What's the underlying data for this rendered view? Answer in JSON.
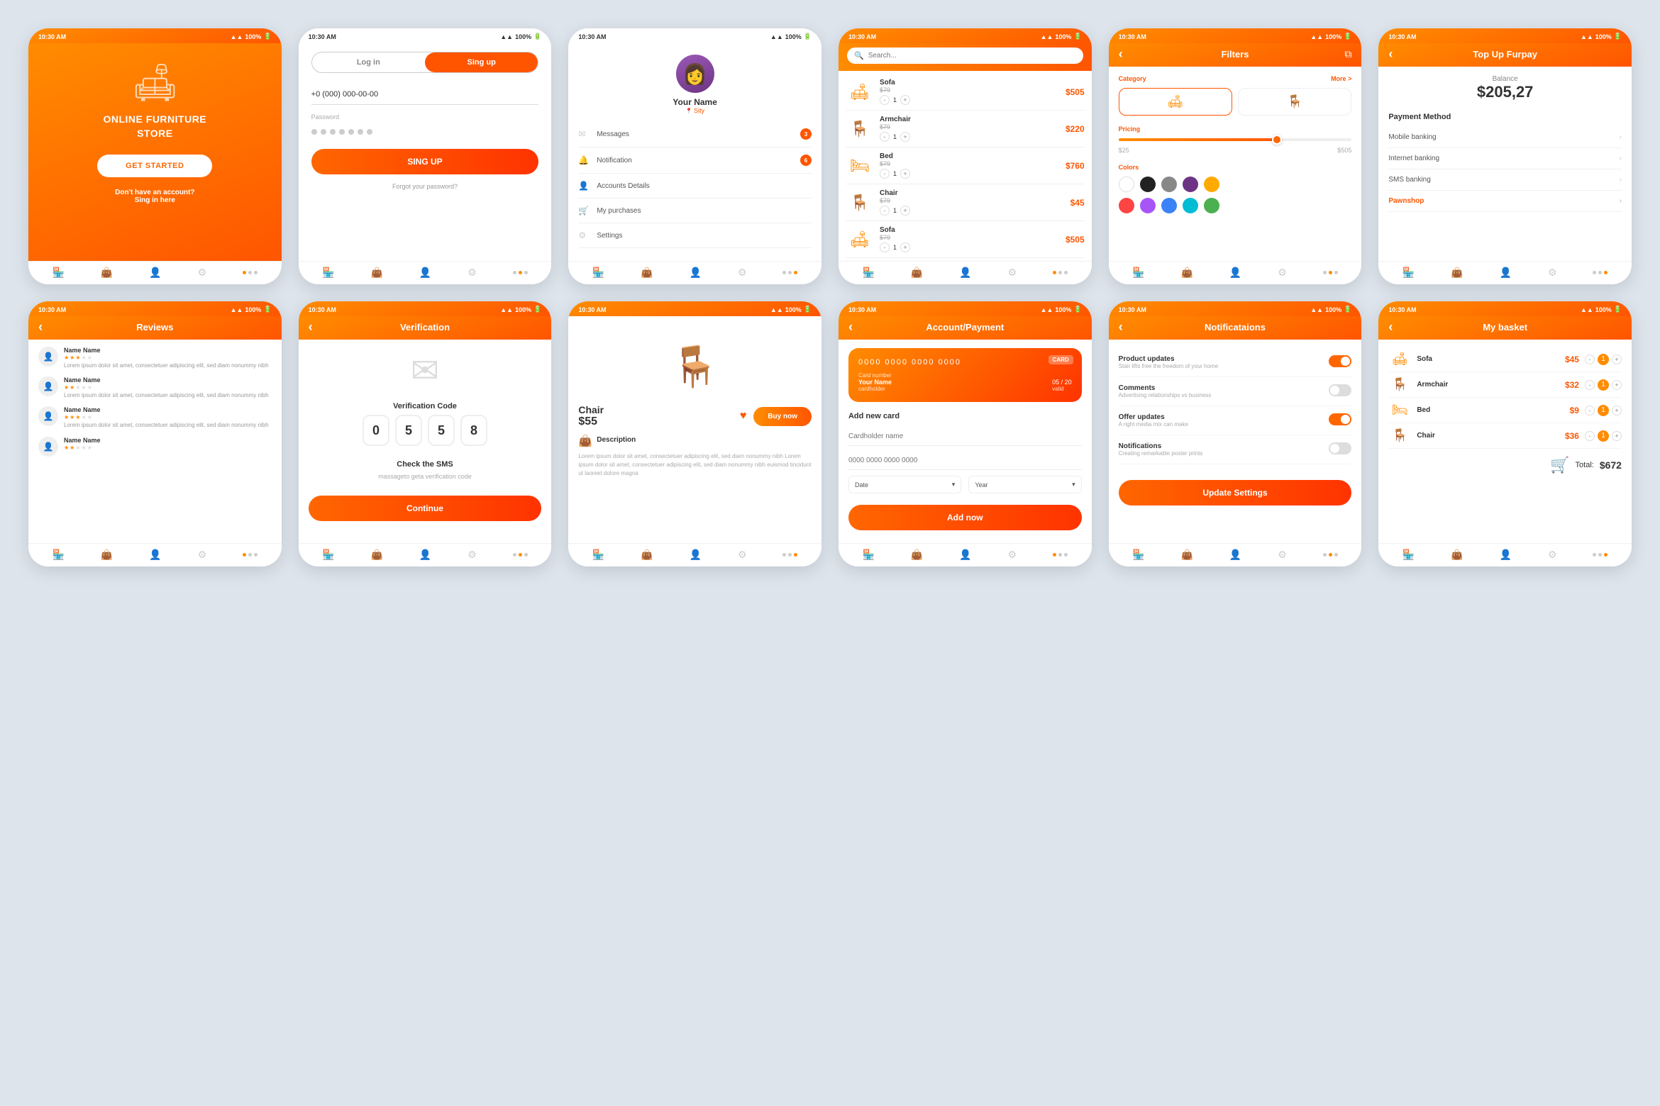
{
  "phone1": {
    "status_time": "10:30 AM",
    "status_battery": "100%",
    "title_line1": "ONLINE FURNITURE",
    "title_line2": "STORE",
    "cta_button": "GET STARTED",
    "signup_prompt": "Don't have an account?",
    "signup_link": "Sing in here"
  },
  "phone2": {
    "status_time": "10:30 AM",
    "status_battery": "100%",
    "tab_login": "Log in",
    "tab_signup": "Sing up",
    "phone_placeholder": "+0 (000) 000-00-00",
    "password_label": "Password",
    "signup_button": "SING UP",
    "forgot_link": "Forgot your password?"
  },
  "phone3": {
    "status_time": "10:30 AM",
    "status_battery": "100%",
    "profile_name": "Your Name",
    "profile_city": "Sity",
    "menu_messages": "Messages",
    "menu_notification": "Notification",
    "menu_accounts": "Accounts Details",
    "menu_purchases": "My purchases",
    "menu_settings": "Settings",
    "badge_messages": "3",
    "badge_notification": "6"
  },
  "phone4": {
    "status_time": "10:30 AM",
    "status_battery": "100%",
    "search_placeholder": "Search...",
    "products": [
      {
        "name": "Sofa",
        "old_price": "$79",
        "price": "$505",
        "qty": 1
      },
      {
        "name": "Armchair",
        "old_price": "$79",
        "price": "$220",
        "qty": 1
      },
      {
        "name": "Bed",
        "old_price": "$79",
        "price": "$760",
        "qty": 1
      },
      {
        "name": "Chair",
        "old_price": "$79",
        "price": "$45",
        "qty": 1
      },
      {
        "name": "Sofa",
        "old_price": "$79",
        "price": "$505",
        "qty": 1
      }
    ]
  },
  "phone5": {
    "status_time": "10:30 AM",
    "status_battery": "100%",
    "title": "Filters",
    "category_label": "Category",
    "more_label": "More >",
    "pricing_label": "Pricing",
    "price_min": "$25",
    "price_max": "$505",
    "colors_label": "Colors",
    "colors": [
      "#fff",
      "#222",
      "#888",
      "#6c3483",
      "#ffaa00",
      "#ff4444",
      "#a855f7",
      "#3b82f6",
      "#00bcd4",
      "#4caf50"
    ]
  },
  "phone6": {
    "status_time": "10:30 AM",
    "status_battery": "100%",
    "title": "Top Up Furpay",
    "balance_label": "Balance",
    "balance_amount": "$205,27",
    "payment_method_label": "Payment Method",
    "methods": [
      "Mobile banking",
      "Internet banking",
      "SMS banking",
      "Pawnshop"
    ]
  },
  "phone7": {
    "status_time": "10:30 AM",
    "status_battery": "100%",
    "title": "Reviews",
    "reviews": [
      {
        "name": "Name Name",
        "stars": 3,
        "text": "Lorem ipsum dolor sit amet, consectetuer adipiscing elit, sed diam nonummy nibh"
      },
      {
        "name": "Name Name",
        "stars": 2,
        "text": "Lorem ipsum dolor sit amet, consectetuer adipiscing elit, sed diam nonummy nibh"
      },
      {
        "name": "Name Name",
        "stars": 3,
        "text": "Lorem ipsum dolor sit amet, consectetuer adipiscing elit, sed diam nonummy nibh"
      },
      {
        "name": "Name Name",
        "stars": 2,
        "text": ""
      }
    ]
  },
  "phone8": {
    "status_time": "10:30 AM",
    "status_battery": "100%",
    "title": "Verification",
    "code_title": "Verification Code",
    "codes": [
      "0",
      "5",
      "5",
      "8"
    ],
    "check_label": "Check the SMS",
    "check_sub": "massageto geta verification code",
    "continue_btn": "Continue"
  },
  "phone9": {
    "status_time": "10:30 AM",
    "status_battery": "100%",
    "product_name": "Chair",
    "product_price": "$55",
    "buy_btn": "Buy now",
    "desc_label": "Description",
    "desc_text": "Lorem ipsum dolor sit amet, consectetuer adipiscing elit, sed diam nonummy nibh Lorem ipsum dolor sit amet, consectetuer adipiscing elit, sed diam nonummy nibh euismod tincidunt ut laoreet dolore magna"
  },
  "phone10": {
    "status_time": "10:30 AM",
    "status_battery": "100%",
    "title": "Account/Payment",
    "card_number": "0000 0000 0000 0000",
    "card_holder_label": "cardholder",
    "card_holder": "Your Name",
    "card_expiry": "05 / 20",
    "card_valid": "valid",
    "card_badge": "CARD",
    "add_card_title": "Add new card",
    "cardholder_placeholder": "Cardholder name",
    "card_num_placeholder": "0000 0000 0000 0000",
    "date_label": "Date",
    "year_label": "Year",
    "add_btn": "Add now"
  },
  "phone11": {
    "status_time": "10:30 AM",
    "status_battery": "100%",
    "title": "Notificataions",
    "items": [
      {
        "title": "Product updates",
        "sub": "Stair lifts free the freedom of your home",
        "on": true
      },
      {
        "title": "Comments",
        "sub": "Advertising relationships vs business",
        "on": false
      },
      {
        "title": "Offer updates",
        "sub": "A right media mix can make",
        "on": true
      },
      {
        "title": "Notifications",
        "sub": "Creating remarkable poster prints",
        "on": false
      }
    ],
    "update_btn": "Update Settings"
  },
  "phone12": {
    "status_time": "10:30 AM",
    "status_battery": "100%",
    "title": "My basket",
    "items": [
      {
        "name": "Sofa",
        "price": "$45",
        "qty": 1
      },
      {
        "name": "Armchair",
        "price": "$32",
        "qty": 1
      },
      {
        "name": "Bed",
        "price": "$9",
        "qty": 1
      },
      {
        "name": "Chair",
        "price": "$36",
        "qty": 1
      }
    ],
    "total_label": "Total:",
    "total_amount": "$672"
  }
}
